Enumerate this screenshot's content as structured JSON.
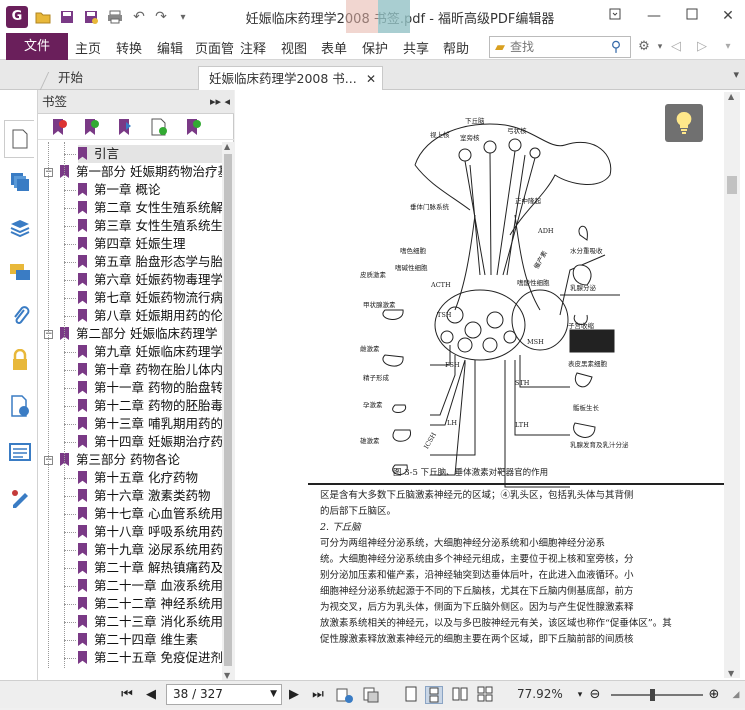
{
  "window": {
    "title": "妊娠临床药理学2008 书签.pdf - 福昕高级PDF编辑器",
    "app_icon": "G"
  },
  "ribbon": {
    "file": "文件",
    "menus": [
      "主页",
      "转换",
      "编辑",
      "页面管",
      "注释",
      "视图",
      "表单",
      "保护",
      "共享",
      "帮助"
    ],
    "search_placeholder": "查找"
  },
  "tabs": [
    {
      "label": "开始"
    },
    {
      "label": "妊娠临床药理学2008 书..."
    }
  ],
  "bookmarks_panel": {
    "title": "书签",
    "items": [
      {
        "label": "引言",
        "level": 1
      },
      {
        "label": "第一部分  妊娠期药物治疗基",
        "level": 0
      },
      {
        "label": "第一章  概论",
        "level": 1
      },
      {
        "label": "第二章  女性生殖系统解",
        "level": 1
      },
      {
        "label": "第三章  女性生殖系统生",
        "level": 1
      },
      {
        "label": "第四章  妊娠生理",
        "level": 1
      },
      {
        "label": "第五章  胎盘形态学与胎",
        "level": 1
      },
      {
        "label": "第六章  妊娠药物毒理学",
        "level": 1
      },
      {
        "label": "第七章  妊娠药物流行病",
        "level": 1
      },
      {
        "label": "第八章  妊娠期用药的伦",
        "level": 1
      },
      {
        "label": "第二部分  妊娠临床药理学",
        "level": 0
      },
      {
        "label": "第九章  妊娠临床药理学",
        "level": 1
      },
      {
        "label": "第十章  药物在胎儿体内",
        "level": 1
      },
      {
        "label": "第十一章  药物的胎盘转",
        "level": 1
      },
      {
        "label": "第十二章  药物的胚胎毒",
        "level": 1
      },
      {
        "label": "第十三章  哺乳期用药的",
        "level": 1
      },
      {
        "label": "第十四章  妊娠期治疗药",
        "level": 1
      },
      {
        "label": "第三部分  药物各论",
        "level": 0
      },
      {
        "label": "第十五章  化疗药物",
        "level": 1
      },
      {
        "label": "第十六章  激素类药物",
        "level": 1
      },
      {
        "label": "第十七章  心血管系统用",
        "level": 1
      },
      {
        "label": "第十八章  呼吸系统用药",
        "level": 1
      },
      {
        "label": "第十九章  泌尿系统用药",
        "level": 1
      },
      {
        "label": "第二十章  解热镇痛药及",
        "level": 1
      },
      {
        "label": "第二十一章  血液系统用",
        "level": 1
      },
      {
        "label": "第二十二章  神经系统用",
        "level": 1
      },
      {
        "label": "第二十三章  消化系统用",
        "level": 1
      },
      {
        "label": "第二十四章  维生素",
        "level": 1
      },
      {
        "label": "第二十五章  免疫促进剂",
        "level": 1
      }
    ]
  },
  "document": {
    "figure_labels": {
      "hypothalamus": "下丘脑",
      "supraoptic": "视上核",
      "paraventricular": "室旁核",
      "arcuate": "弓状核",
      "median_eminence": "正中隆起",
      "portal": "垂体门脉系统",
      "basophil": "嗜色细胞",
      "acidophil": "嗜碱性细胞",
      "eosinophil": "嗜酸性细胞",
      "adh": "ADH",
      "water": "水分重吸收",
      "prl_cells": "催产素",
      "milk": "乳腺分泌",
      "uterus": "子宫收缩",
      "msh": "MSH",
      "melanocyte": "表皮黑素细胞",
      "sth": "STH",
      "bone": "骺板生长",
      "lth": "LTH",
      "breast": "乳腺发育及乳汁分泌",
      "acth": "ACTH",
      "adrenal": "皮质激素",
      "tsh": "TSH",
      "thyroid": "甲状腺激素",
      "fsh": "FSH",
      "estrogen": "雌激素",
      "sperm": "精子形成",
      "lh": "LH",
      "progest": "孕激素",
      "icsh": "ICSH",
      "androgen": "雄激素"
    },
    "caption": "图 3-5   下丘脑、垂体激素对靶器官的作用",
    "lines": [
      "区是含有大多数下丘脑激素神经元的区域；④乳头区，包括乳头体与其背侧",
      "的后部下丘脑区。",
      "    2. 下丘脑",
      "    可分为两组神经分泌系统，大细胞神经分泌系统和小细胞神经分泌系",
      "统。大细胞神经分泌系统由多个神经元组成，主要位于视上核和室旁核，分",
      "别分泌加压素和催产素，沿神经轴突到达垂体后叶，在此进入血液循环。小",
      "细胞神经分泌系统起源于不同的下丘脑核，尤其在下丘脑内侧基底部，前方",
      "为视交叉，后方为乳头体，侧面为下丘脑外侧区。因为与产生促性腺激素释",
      "放激素系统相关的神经元，以及与多巴胺神经元有关，该区域也称作“促垂体区”。其",
      "促性腺激素释放激素神经元的细胞主要在两个区域，即下丘脑前部的间质核"
    ]
  },
  "statusbar": {
    "page": "38 / 327",
    "zoom": "77.92%",
    "zoom_level": 0.45
  }
}
